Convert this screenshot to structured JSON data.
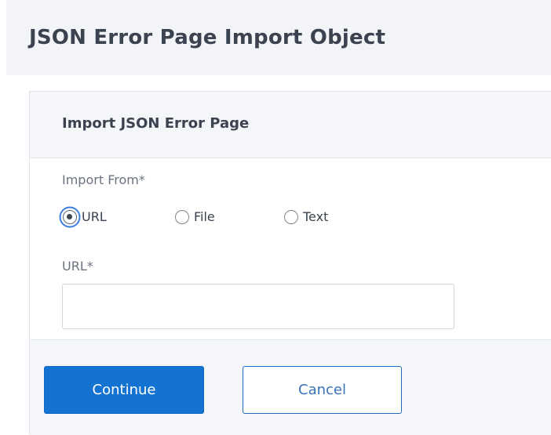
{
  "page": {
    "title": "JSON Error Page Import Object"
  },
  "panel": {
    "title": "Import JSON Error Page",
    "import_from_label": "Import From*",
    "radio_options": [
      {
        "label": "URL",
        "selected": true
      },
      {
        "label": "File",
        "selected": false
      },
      {
        "label": "Text",
        "selected": false
      }
    ],
    "url_label": "URL*",
    "url_value": "",
    "url_placeholder": ""
  },
  "footer": {
    "continue_label": "Continue",
    "cancel_label": "Cancel"
  },
  "colors": {
    "primary": "#1473d1",
    "focus_ring": "#3b7ee0",
    "title_text": "#3b4350",
    "header_bg": "#f3f4f7"
  }
}
